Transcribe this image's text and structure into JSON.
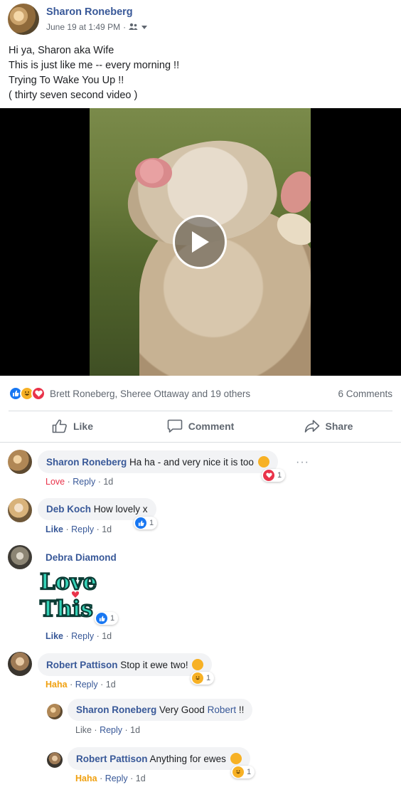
{
  "post": {
    "author": "Sharon Roneberg",
    "timestamp": "June 19 at 1:49 PM",
    "separator": "·",
    "audience_icon": "friends-icon",
    "text_lines": [
      "Hi ya, Sharon aka Wife",
      "This is just like me -- every morning !!",
      "Trying To Wake You Up !!",
      "( thirty seven second video )"
    ]
  },
  "reactions": {
    "icons": [
      "like",
      "haha",
      "love"
    ],
    "names": "Brett Roneberg, Sheree Ottaway and 19 others",
    "comments_count": "6 Comments"
  },
  "actions": {
    "like": "Like",
    "comment": "Comment",
    "share": "Share"
  },
  "comments": [
    {
      "author": "Sharon Roneberg",
      "text": "Ha ha - and very nice it is too",
      "reaction_label": "Love",
      "reply": "Reply",
      "time": "1d",
      "badge_count": "1"
    },
    {
      "author": "Deb Koch",
      "text": "How lovely x",
      "reaction_label": "Like",
      "reply": "Reply",
      "time": "1d",
      "badge_count": "1"
    },
    {
      "author": "Debra Diamond",
      "sticker_line1": "Love",
      "sticker_line2": "This",
      "reaction_label": "Like",
      "reply": "Reply",
      "time": "1d",
      "badge_count": "1"
    },
    {
      "author": "Robert Pattison",
      "text": "Stop it ewe two!",
      "reaction_label": "Haha",
      "reply": "Reply",
      "time": "1d",
      "badge_count": "1"
    }
  ],
  "replies": [
    {
      "author": "Sharon Roneberg",
      "text_before": "Very Good",
      "mention": "Robert",
      "text_after": "!!",
      "reaction_label": "Like",
      "reply": "Reply",
      "time": "1d"
    },
    {
      "author": "Robert Pattison",
      "text": "Anything for ewes",
      "reaction_label": "Haha",
      "reply": "Reply",
      "time": "1d",
      "badge_count": "1"
    }
  ],
  "colors": {
    "link_blue": "#385898",
    "love_red": "#e9334a",
    "haha_orange": "#f0a00f",
    "like_blue": "#1877f2"
  }
}
